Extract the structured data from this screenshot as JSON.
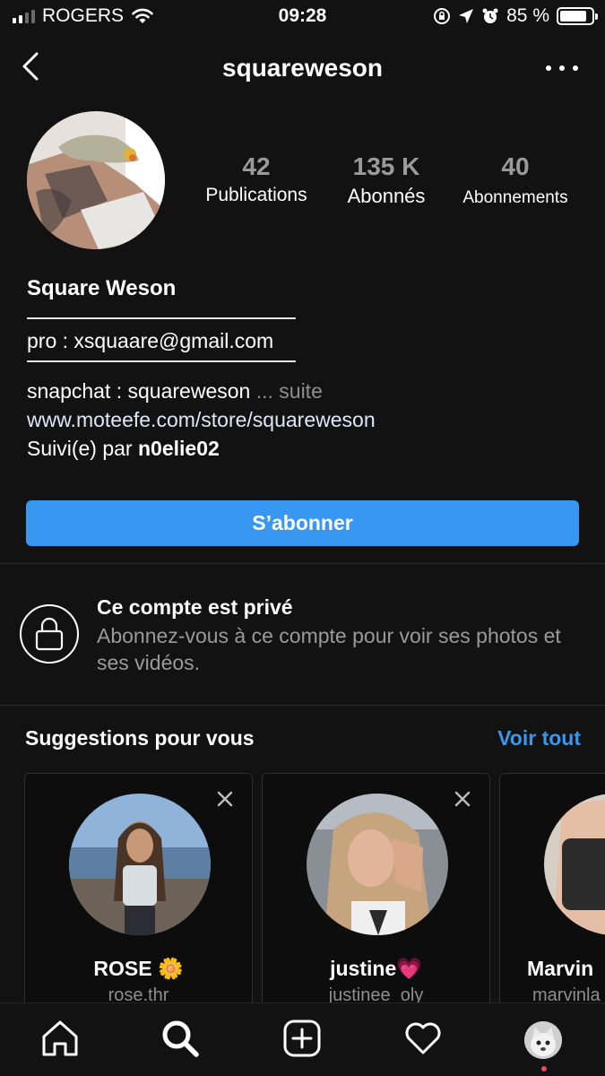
{
  "status_bar": {
    "carrier": "ROGERS",
    "time": "09:28",
    "battery_text": "85 %",
    "battery_level": 0.85
  },
  "header": {
    "username": "squareweson",
    "back_icon": "chevron-left-icon",
    "more_icon": "more-horizontal-icon"
  },
  "stats": [
    {
      "value": "42",
      "label": "Publications"
    },
    {
      "value": "135 K",
      "label": "Abonnés"
    },
    {
      "value": "40",
      "label": "Abonnements"
    }
  ],
  "bio": {
    "name": "Square Weson",
    "email_line": "pro : xsquaare@gmail.com",
    "snapchat_line": "snapchat : squareweson",
    "more_label": "... suite",
    "website": "www.moteefe.com/store/squareweson",
    "followed_by_prefix": "Suivi(e) par ",
    "followed_by_user": "n0elie02"
  },
  "subscribe_label": "S’abonner",
  "private": {
    "title": "Ce compte est privé",
    "text": "Abonnez-vous à ce compte pour voir ses photos et ses vidéos."
  },
  "suggestions": {
    "title": "Suggestions pour vous",
    "see_all": "Voir tout",
    "cards": [
      {
        "name": "ROSE 🌼",
        "handle": "rose.thr"
      },
      {
        "name": "justine💗",
        "handle": "justinee_oly"
      },
      {
        "name": "Marvin",
        "handle": "marvinla"
      }
    ]
  },
  "colors": {
    "background": "#121212",
    "accent": "#3897f0",
    "secondary_text": "#9a9a9a"
  },
  "tabbar": {
    "items": [
      "home-icon",
      "search-icon",
      "add-post-icon",
      "heart-icon",
      "profile-avatar"
    ]
  }
}
